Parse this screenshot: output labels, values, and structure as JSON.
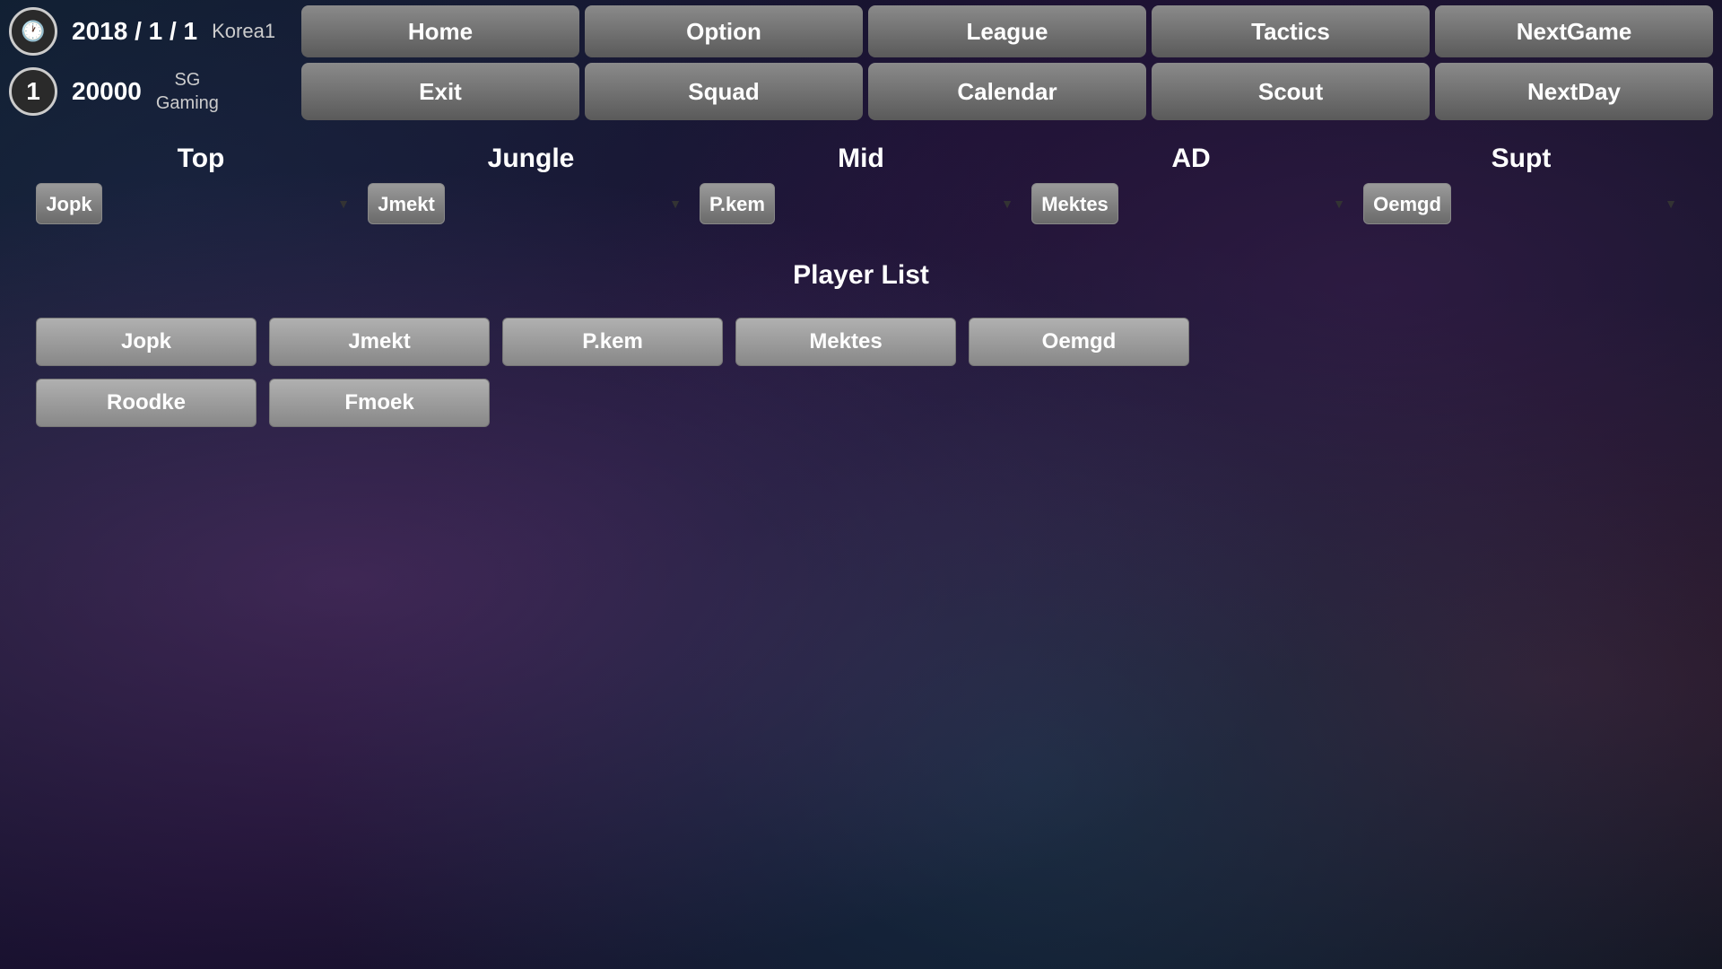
{
  "header": {
    "clock_icon": "🕐",
    "date": "2018 / 1 / 1",
    "region": "Korea1",
    "rank": "1",
    "money": "20000",
    "team_line1": "SG",
    "team_line2": "Gaming"
  },
  "nav_row1": {
    "home": "Home",
    "option": "Option",
    "league": "League",
    "tactics": "Tactics",
    "nextgame": "NextGame"
  },
  "nav_row2": {
    "exit": "Exit",
    "squad": "Squad",
    "calendar": "Calendar",
    "scout": "Scout",
    "nextday": "NextDay"
  },
  "positions": {
    "top_label": "Top",
    "jungle_label": "Jungle",
    "mid_label": "Mid",
    "ad_label": "AD",
    "supt_label": "Supt",
    "top_selected": "Jopk",
    "jungle_selected": "Jmekt",
    "mid_selected": "P.kem",
    "ad_selected": "Mektes",
    "supt_selected": "Oemgd"
  },
  "player_list": {
    "title": "Player List",
    "players": [
      {
        "name": "Jopk"
      },
      {
        "name": "Jmekt"
      },
      {
        "name": "P.kem"
      },
      {
        "name": "Mektes"
      },
      {
        "name": "Oemgd"
      },
      {
        "name": "Roodke"
      },
      {
        "name": "Fmoek"
      }
    ]
  }
}
